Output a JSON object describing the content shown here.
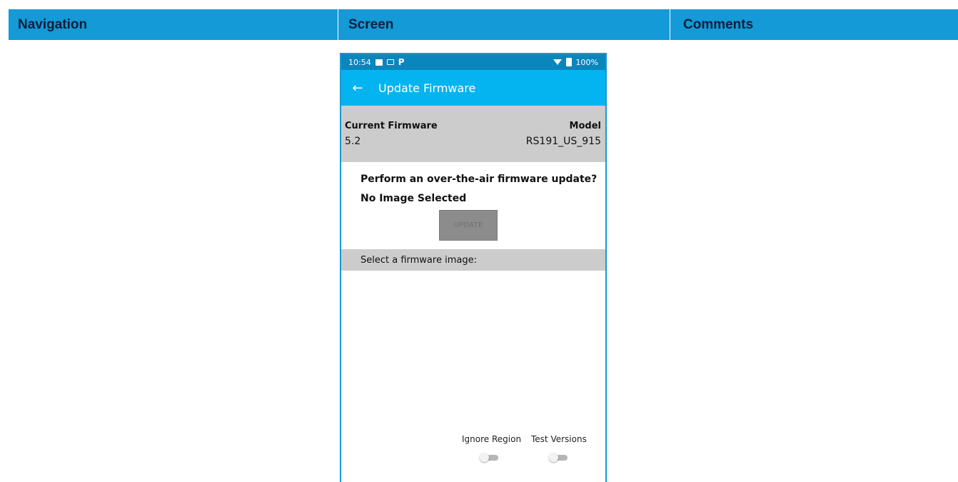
{
  "table_header": {
    "navigation": "Navigation",
    "screen": "Screen",
    "comments": "Comments"
  },
  "status_bar": {
    "time": "10:54",
    "p_icon": "P",
    "battery": "100%"
  },
  "app_bar": {
    "back_icon": "←",
    "title": "Update Firmware"
  },
  "firmware_info": {
    "current_label": "Current Firmware",
    "current_value": "5.2",
    "model_label": "Model",
    "model_value": "RS191_US_915"
  },
  "update": {
    "question": "Perform an over-the-air firmware update?",
    "selection_status": "No Image Selected",
    "button_label": "UPDATE"
  },
  "select_image_label": "Select a firmware image:",
  "toggles": {
    "ignore_region": {
      "label": "Ignore Region",
      "on": false
    },
    "test_versions": {
      "label": "Test Versions",
      "on": false
    }
  },
  "colors": {
    "header_blue": "#149ad6",
    "app_bar": "#04b4f0",
    "status_bar": "#0a86bd",
    "panel_gray": "#cccccc"
  }
}
